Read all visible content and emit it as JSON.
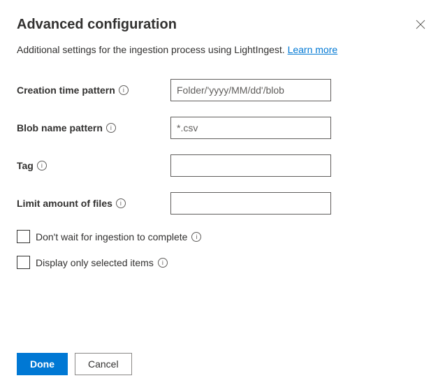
{
  "header": {
    "title": "Advanced configuration"
  },
  "subtitle": {
    "text": "Additional settings for the ingestion process using LightIngest. ",
    "link": "Learn more"
  },
  "fields": {
    "creationTime": {
      "label": "Creation time pattern",
      "placeholder": "Folder/'yyyy/MM/dd'/blob",
      "value": ""
    },
    "blobName": {
      "label": "Blob name pattern",
      "placeholder": "*.csv",
      "value": ""
    },
    "tag": {
      "label": "Tag",
      "placeholder": "",
      "value": ""
    },
    "limitFiles": {
      "label": "Limit amount of files",
      "placeholder": "",
      "value": ""
    }
  },
  "checkboxes": {
    "dontWait": {
      "label": "Don't wait for ingestion to complete"
    },
    "displayOnly": {
      "label": "Display only selected items"
    }
  },
  "footer": {
    "done": "Done",
    "cancel": "Cancel"
  },
  "info": "i"
}
